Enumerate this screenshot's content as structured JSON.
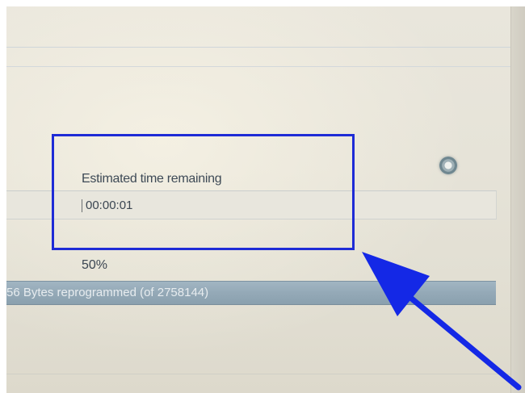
{
  "dialog": {
    "time_label": "Estimated time remaining",
    "time_value": "00:00:01",
    "percent_text": "50%",
    "progress_text": "56 Bytes reprogrammed (of 2758144)",
    "progress_fraction": 0.5
  },
  "annotation": {
    "box_color": "#1e2bd6",
    "arrow_color": "#1428e6",
    "arrow_icon": "arrow-up-left-icon"
  },
  "colors": {
    "background": "#e6e3d8",
    "progress_bar": "#94a9b7",
    "text": "#3e4a56"
  }
}
